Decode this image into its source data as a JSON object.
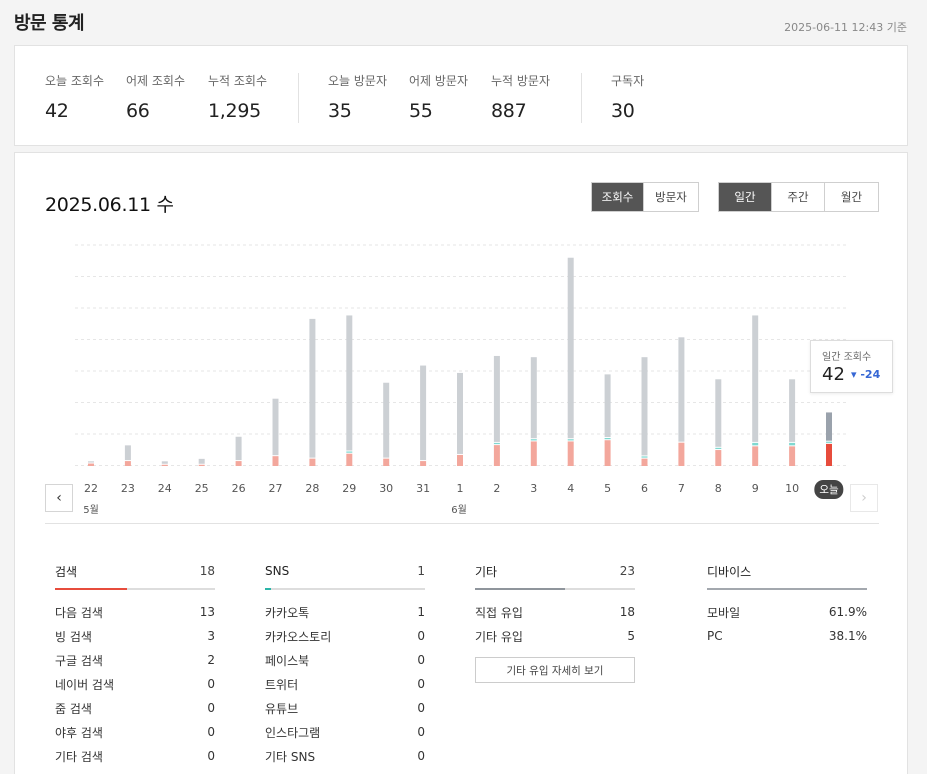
{
  "header": {
    "title": "방문 통계",
    "timestamp": "2025-06-11 12:43 기준"
  },
  "summary": [
    {
      "label": "오늘 조회수",
      "value": "42"
    },
    {
      "label": "어제 조회수",
      "value": "66"
    },
    {
      "label": "누적 조회수",
      "value": "1,295"
    },
    {
      "label": "오늘 방문자",
      "value": "35"
    },
    {
      "label": "어제 방문자",
      "value": "55"
    },
    {
      "label": "누적 방문자",
      "value": "887"
    },
    {
      "label": "구독자",
      "value": "30"
    }
  ],
  "date_title": "2025.06.11 수",
  "metric_toggle": [
    {
      "label": "조회수",
      "active": true
    },
    {
      "label": "방문자",
      "active": false
    }
  ],
  "period_toggle": [
    {
      "label": "일간",
      "active": true
    },
    {
      "label": "주간",
      "active": false
    },
    {
      "label": "월간",
      "active": false
    }
  ],
  "tooltip": {
    "label": "일간 조회수",
    "value": "42",
    "delta": "▾ -24"
  },
  "month_labels": [
    "5월",
    "6월"
  ],
  "colors": {
    "bar_gray": "#ccd0d4",
    "bar_red": "#f3a79c",
    "bar_teal": "#7fd8d0",
    "today_gray": "#9aa2ac",
    "today_red": "#e74c3c",
    "accent_blue": "#3667d4"
  },
  "chart_data": {
    "type": "bar",
    "stacked": true,
    "categories": [
      "22",
      "23",
      "24",
      "25",
      "26",
      "27",
      "28",
      "29",
      "30",
      "31",
      "1",
      "2",
      "3",
      "4",
      "5",
      "6",
      "7",
      "8",
      "9",
      "10",
      "오늘"
    ],
    "series": [
      {
        "values": [
          2,
          4,
          1,
          1,
          4,
          8,
          6,
          10,
          6,
          4,
          9,
          17,
          20,
          20,
          21,
          6,
          19,
          13,
          16,
          16,
          18
        ]
      },
      {
        "values": [
          0,
          0,
          0,
          0,
          0,
          0,
          0,
          1,
          0,
          0,
          0,
          1,
          1,
          1,
          1,
          1,
          0,
          1,
          2,
          2,
          1
        ]
      },
      {
        "values": [
          1,
          12,
          2,
          4,
          19,
          46,
          113,
          110,
          61,
          77,
          66,
          70,
          66,
          147,
          51,
          80,
          85,
          55,
          103,
          51,
          23
        ]
      }
    ],
    "ylim": [
      0,
      180
    ],
    "grid": true
  },
  "referrers": {
    "search": {
      "title": "검색",
      "count": "18",
      "fill": 0.45,
      "rows": [
        {
          "label": "다음 검색",
          "value": "13"
        },
        {
          "label": "빙 검색",
          "value": "3"
        },
        {
          "label": "구글 검색",
          "value": "2"
        },
        {
          "label": "네이버 검색",
          "value": "0"
        },
        {
          "label": "줌 검색",
          "value": "0"
        },
        {
          "label": "야후 검색",
          "value": "0"
        },
        {
          "label": "기타 검색",
          "value": "0"
        }
      ]
    },
    "sns": {
      "title": "SNS",
      "count": "1",
      "fill": 0.04,
      "rows": [
        {
          "label": "카카오톡",
          "value": "1"
        },
        {
          "label": "카카오스토리",
          "value": "0"
        },
        {
          "label": "페이스북",
          "value": "0"
        },
        {
          "label": "트위터",
          "value": "0"
        },
        {
          "label": "유튜브",
          "value": "0"
        },
        {
          "label": "인스타그램",
          "value": "0"
        },
        {
          "label": "기타 SNS",
          "value": "0"
        }
      ]
    },
    "etc": {
      "title": "기타",
      "count": "23",
      "fill": 0.56,
      "rows": [
        {
          "label": "직접 유입",
          "value": "18"
        },
        {
          "label": "기타 유입",
          "value": "5"
        }
      ],
      "button": "기타 유입 자세히 보기"
    },
    "device": {
      "title": "디바이스",
      "fill": 1,
      "rows": [
        {
          "label": "모바일",
          "value": "61.9%"
        },
        {
          "label": "PC",
          "value": "38.1%"
        }
      ]
    }
  }
}
